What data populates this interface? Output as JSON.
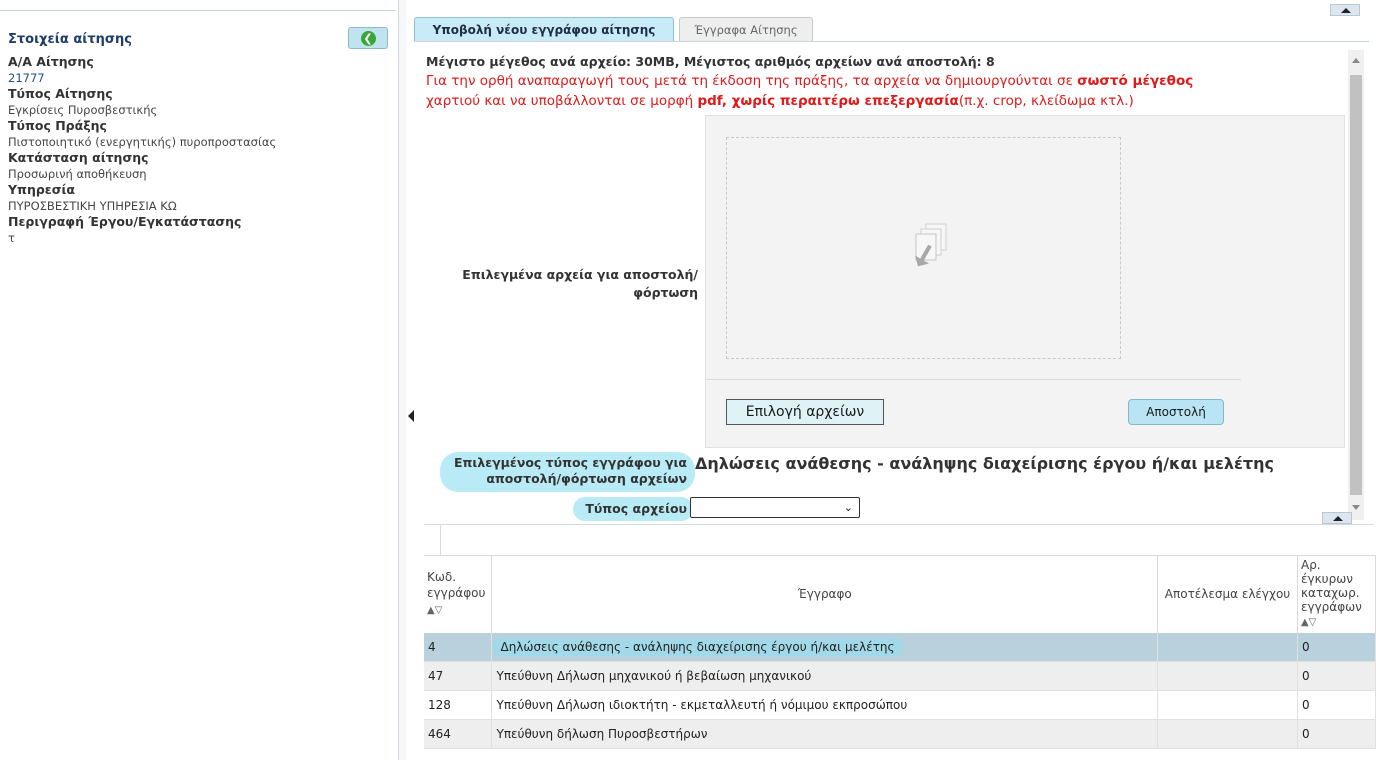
{
  "left": {
    "title": "Στοιχεία αίτησης",
    "fields": [
      {
        "label": "Α/Α Αίτησης",
        "value": "21777"
      },
      {
        "label": "Τύπος Αίτησης",
        "value": "Εγκρίσεις Πυροσβεστικής"
      },
      {
        "label": "Τύπος Πράξης",
        "value": "Πιστοποιητικό (ενεργητικής) πυροπροστασίας"
      },
      {
        "label": "Κατάσταση αίτησης",
        "value": "Προσωρινή αποθήκευση"
      },
      {
        "label": "Υπηρεσία",
        "value": "ΠΥΡΟΣΒΕΣΤΙΚΗ ΥΠΗΡΕΣΙΑ ΚΩ"
      },
      {
        "label": "Περιγραφή Έργου/Εγκατάστασης",
        "value": "τ"
      }
    ]
  },
  "tabs": {
    "upload": "Υποβολή νέου εγγράφου αίτησης",
    "documents": "Έγγραφα Αίτησης"
  },
  "upload": {
    "max_size": "Μέγιστο μέγεθος ανά αρχείο: 30MB, Μέγιστος αριθμός αρχείων ανά αποστολή: 8",
    "notice_1": "Για την ορθή αναπαραγωγή τους μετά τη έκδοση της πράξης, τα αρχεία να δημιουργούνται σε ",
    "notice_bold_1": "σωστό μέγεθος",
    "notice_2": "χαρτιού και να υποβάλλονται σε μορφή ",
    "notice_bold_2": "pdf, χωρίς περαιτέρω επεξεργασία",
    "notice_3": "(π.χ. crop, κλείδωμα κτλ.)",
    "selected_files_label": "Επιλεγμένα αρχεία για αποστολή/ φόρτωση",
    "select_button": "Επιλογή αρχείων",
    "send_button": "Αποστολή",
    "doc_type_label": "Επιλεγμένος τύπος εγγράφου για αποστολή/φόρτωση αρχείων",
    "doc_type_value": "Δηλώσεις ανάθεσης - ανάληψης διαχείρισης έργου ή/και μελέτης",
    "file_type_label": "Τύπος αρχείου",
    "file_type_value": ""
  },
  "table": {
    "headers": {
      "code": "Κωδ. εγγράφου",
      "document": "Έγγραφο",
      "result": "Αποτέλεσμα ελέγχου",
      "count": "Αρ. έγκυρων καταχωρ. εγγράφων"
    },
    "rows": [
      {
        "code": "4",
        "document": "Δηλώσεις ανάθεσης - ανάληψης διαχείρισης έργου ή/και μελέτης",
        "result": "",
        "count": "0"
      },
      {
        "code": "47",
        "document": "Υπεύθυνη Δήλωση μηχανικού ή βεβαίωση μηχανικού",
        "result": "",
        "count": "0"
      },
      {
        "code": "128",
        "document": "Υπεύθυνη Δήλωση ιδιοκτήτη - εκμεταλλευτή ή νόμιμου εκπροσώπου",
        "result": "",
        "count": "0"
      },
      {
        "code": "464",
        "document": "Υπεύθυνη δήλωση Πυροσβεστήρων",
        "result": "",
        "count": "0"
      }
    ]
  },
  "icons": {
    "back": "circle-arrow-left-icon",
    "drop": "files-drop-icon",
    "collapse": "triangle-up-icon"
  },
  "colors": {
    "notice": "#e01a1a",
    "tab_active": "#c9eaf7",
    "highlight": "#b8ebf5",
    "row_selected": "#b9d0dd"
  }
}
